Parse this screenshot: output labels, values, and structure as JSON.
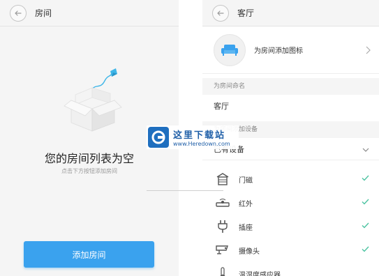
{
  "left_screen": {
    "title": "房间",
    "empty_title": "您的房间列表为空",
    "empty_hint": "点击下方按钮添加房间",
    "add_button": "添加房间"
  },
  "right_screen": {
    "title": "客厅",
    "add_icon_label": "为房间添加图标",
    "name_section": "为房间命名",
    "room_name": "客厅",
    "devices_section": "为房间添加设备",
    "devices_group": "已有设备",
    "devices": [
      {
        "label": "门磁",
        "icon": "door-sensor-icon",
        "checked": true
      },
      {
        "label": "红外",
        "icon": "infrared-icon",
        "checked": true
      },
      {
        "label": "插座",
        "icon": "plug-icon",
        "checked": true
      },
      {
        "label": "摄像头",
        "icon": "camera-icon",
        "checked": true
      },
      {
        "label": "温湿度感应器",
        "icon": "thermometer-icon",
        "checked": false
      }
    ]
  },
  "watermark": {
    "text": "这里下载站",
    "url": "www.Heredown.com"
  },
  "colors": {
    "accent": "#3aa2ee",
    "check": "#4cc3a1",
    "background": "#f5f5f5"
  }
}
